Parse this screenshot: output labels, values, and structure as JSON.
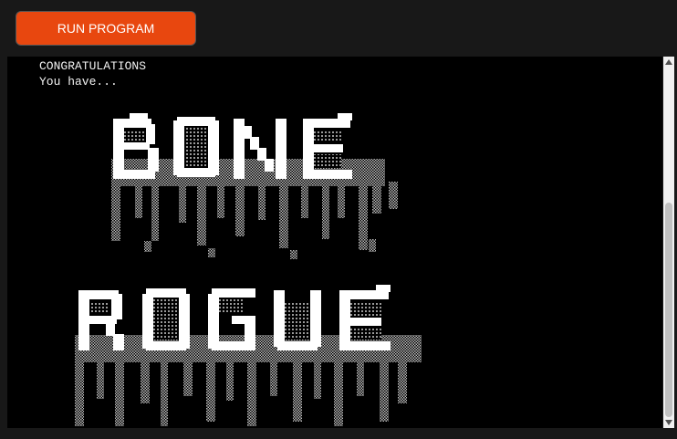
{
  "toolbar": {
    "run_label": "RUN PROGRAM"
  },
  "terminal": {
    "lines": [
      "CONGRATULATIONS",
      "You have..."
    ],
    "banner_words": [
      "BONE",
      "ROGUE"
    ]
  },
  "colors": {
    "accent": "#e8470f",
    "terminal_bg": "#000000",
    "terminal_fg": "#f2f2f2",
    "page_bg": "#181818"
  },
  "icons": {
    "scroll_up": "triangle-up",
    "scroll_down": "triangle-down"
  }
}
